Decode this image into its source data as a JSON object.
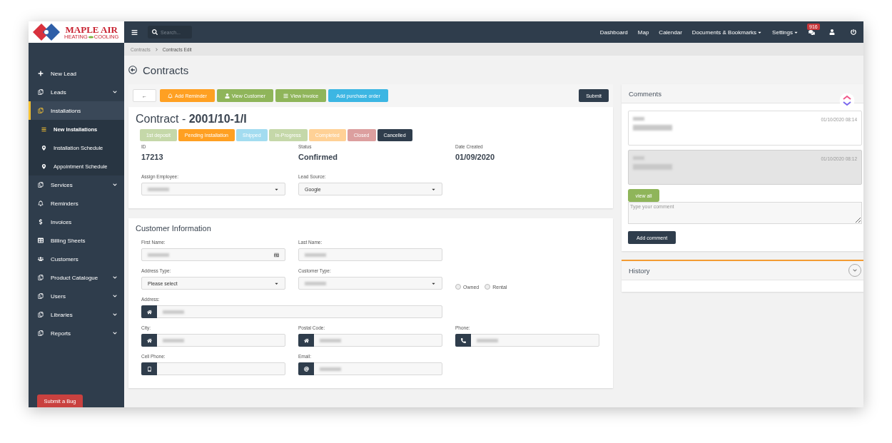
{
  "brand": {
    "name": "MAPLE AIR",
    "tagline_left": "HEATING",
    "tagline_right": "COOLING"
  },
  "topbar": {
    "search_placeholder": "Search...",
    "nav": [
      {
        "label": "Dashboard",
        "dropdown": false
      },
      {
        "label": "Map",
        "dropdown": false
      },
      {
        "label": "Calendar",
        "dropdown": false
      },
      {
        "label": "Documents & Bookmarks",
        "dropdown": true
      },
      {
        "label": "Settings",
        "dropdown": true
      }
    ],
    "badge": "916"
  },
  "sidebar": {
    "items": [
      {
        "label": "New Lead",
        "selected": false,
        "expandable": false
      },
      {
        "label": "Leads",
        "selected": false,
        "expandable": true
      },
      {
        "label": "Installations",
        "selected": true,
        "expandable": false,
        "children": [
          {
            "label": "New Installations",
            "selected": true
          },
          {
            "label": "Installation Schedule",
            "selected": false
          },
          {
            "label": "Appointment Schedule",
            "selected": false
          }
        ]
      },
      {
        "label": "Services",
        "selected": false,
        "expandable": true
      },
      {
        "label": "Reminders",
        "selected": false,
        "expandable": false
      },
      {
        "label": "Invoices",
        "selected": false,
        "expandable": false
      },
      {
        "label": "Billing Sheets",
        "selected": false,
        "expandable": false
      },
      {
        "label": "Customers",
        "selected": false,
        "expandable": false
      },
      {
        "label": "Product Catalogue",
        "selected": false,
        "expandable": true
      },
      {
        "label": "Users",
        "selected": false,
        "expandable": true
      },
      {
        "label": "Libraries",
        "selected": false,
        "expandable": true
      },
      {
        "label": "Reports",
        "selected": false,
        "expandable": true
      }
    ],
    "bug_button": "Submit a Bug"
  },
  "breadcrumb": [
    "Contracts",
    "Contracts Edit"
  ],
  "page_title": "Contracts",
  "toolbar": {
    "buttons": [
      {
        "kind": "back",
        "label": "←",
        "color": "#ffffff"
      },
      {
        "kind": "bell",
        "label": "Add Reminder",
        "color": "#ffa022"
      },
      {
        "kind": "user",
        "label": "View Customer",
        "color": "#8fb55a"
      },
      {
        "kind": "list",
        "label": "View Invoice",
        "color": "#8fb55a"
      },
      {
        "kind": "plain",
        "label": "Add purchase order",
        "color": "#3cb6e3"
      }
    ],
    "submit": "Submit"
  },
  "contract": {
    "title_prefix": "Contract - ",
    "number": "2001/10-1/I",
    "stages": [
      {
        "label": "1st deposit",
        "color": "#c5d8a9"
      },
      {
        "label": "Pending Installation",
        "color": "#ffa022"
      },
      {
        "label": "Shipped",
        "color": "#a3dcf0"
      },
      {
        "label": "In-Progress",
        "color": "#c5d8a9"
      },
      {
        "label": "Completed",
        "color": "#ffd196"
      },
      {
        "label": "Closed",
        "color": "#dc9f9f"
      },
      {
        "label": "Cancelled",
        "color": "#2f3d4c"
      }
    ],
    "facts": [
      {
        "label": "ID",
        "value": "17213"
      },
      {
        "label": "Status",
        "value": "Confirmed"
      },
      {
        "label": "Date Created",
        "value": "01/09/2020"
      }
    ],
    "selects": [
      {
        "label": "Assign Employee:",
        "blurred": true
      },
      {
        "label": "Lead Source:",
        "value": "Google",
        "blurred": false
      }
    ]
  },
  "customer": {
    "title": "Customer Information",
    "rows": [
      [
        {
          "kind": "text",
          "label": "First Name:",
          "blurred": true
        },
        {
          "kind": "text",
          "label": "Last Name:",
          "blurred": true
        }
      ],
      [
        {
          "kind": "select",
          "label": "Address Type:",
          "value": "Please select",
          "blurred": false
        },
        {
          "kind": "select",
          "label": "Customer Type:",
          "blurred": true
        },
        {
          "kind": "radios",
          "options": [
            {
              "label": "Owned",
              "selected": false
            },
            {
              "label": "Rental",
              "selected": false
            }
          ]
        }
      ],
      [
        {
          "kind": "home",
          "label": "Address:",
          "blurred": true
        }
      ],
      [
        {
          "kind": "home",
          "label": "City:",
          "blurred": true
        },
        {
          "kind": "home",
          "label": "Postal Code:",
          "blurred": true
        },
        {
          "kind": "phone",
          "label": "Phone:",
          "blurred": true
        }
      ],
      [
        {
          "kind": "mobile",
          "label": "Cell Phone:",
          "blurred": false
        },
        {
          "kind": "email",
          "label": "Email:",
          "blurred": true
        }
      ]
    ]
  },
  "comments": {
    "title": "Comments",
    "items": [
      {
        "date": "01/10/2020 08:14",
        "highlighted": false
      },
      {
        "date": "01/10/2020 08:12",
        "highlighted": true
      }
    ],
    "view_all": "view all",
    "placeholder": "Type your comment",
    "add": "Add comment"
  },
  "history": {
    "title": "History",
    "expanded": false
  }
}
